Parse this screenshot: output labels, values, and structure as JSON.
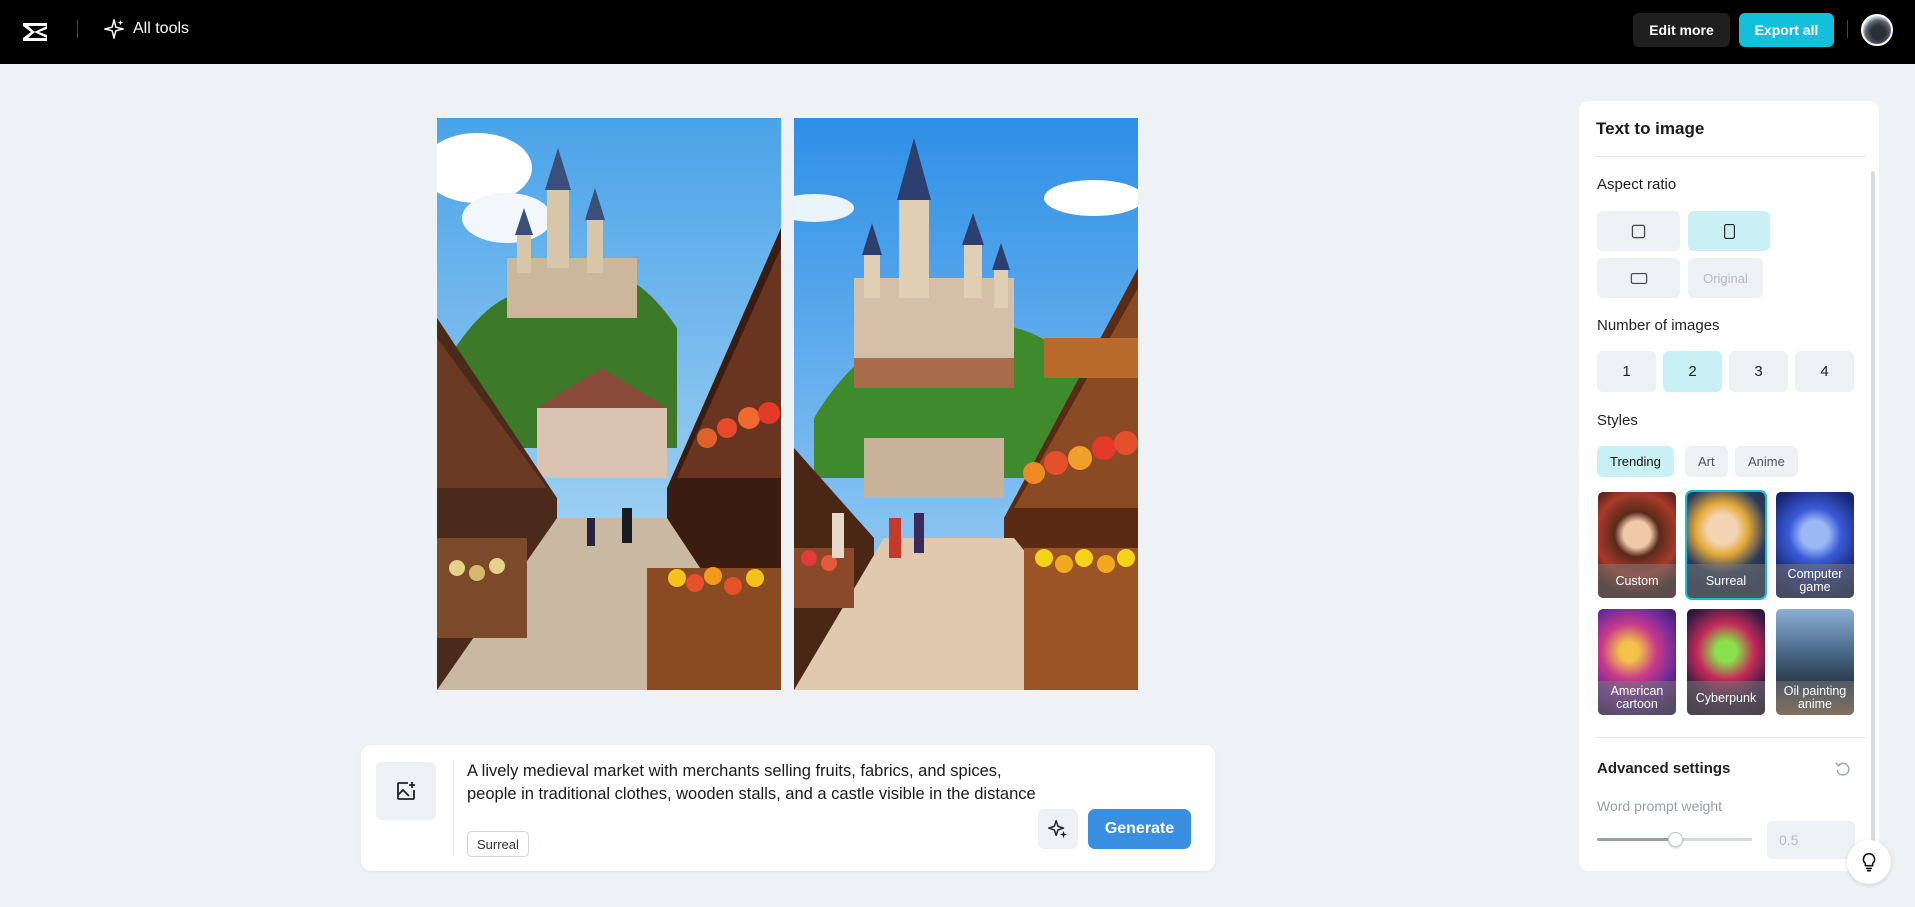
{
  "topbar": {
    "all_tools_label": "All tools",
    "edit_more_label": "Edit more",
    "export_all_label": "Export all"
  },
  "prompt": {
    "text": "A lively medieval market with merchants selling fruits, fabrics, and spices, people in traditional clothes, wooden stalls, and a castle visible in the distance",
    "style_tag": "Surreal",
    "generate_label": "Generate"
  },
  "panel": {
    "title": "Text to image",
    "aspect_ratio_label": "Aspect ratio",
    "aspect_original_label": "Original",
    "number_label": "Number of images",
    "numbers": [
      "1",
      "2",
      "3",
      "4"
    ],
    "selected_number": "2",
    "styles_label": "Styles",
    "style_tabs": [
      "Trending",
      "Art",
      "Anime"
    ],
    "styles": [
      {
        "name": "Custom"
      },
      {
        "name": "Surreal"
      },
      {
        "name": "Computer game"
      },
      {
        "name": "American cartoon"
      },
      {
        "name": "Cyberpunk"
      },
      {
        "name": "Oil painting anime"
      }
    ],
    "advanced_label": "Advanced settings",
    "word_prompt_label": "Word prompt weight",
    "word_prompt_value": "0.5",
    "word_prompt_slider_fraction": 0.5
  },
  "colors": {
    "accent": "#13c0dc",
    "generate": "#3a8fe0",
    "selected_bg": "#c9f0f5",
    "topbar": "#000000"
  },
  "icons": [
    "capcut-logo-icon",
    "sparkle-icon",
    "avatar",
    "image-upload-icon",
    "magic-enhance-icon",
    "square-icon",
    "portrait-icon",
    "landscape-icon",
    "reset-icon",
    "lightbulb-icon"
  ]
}
